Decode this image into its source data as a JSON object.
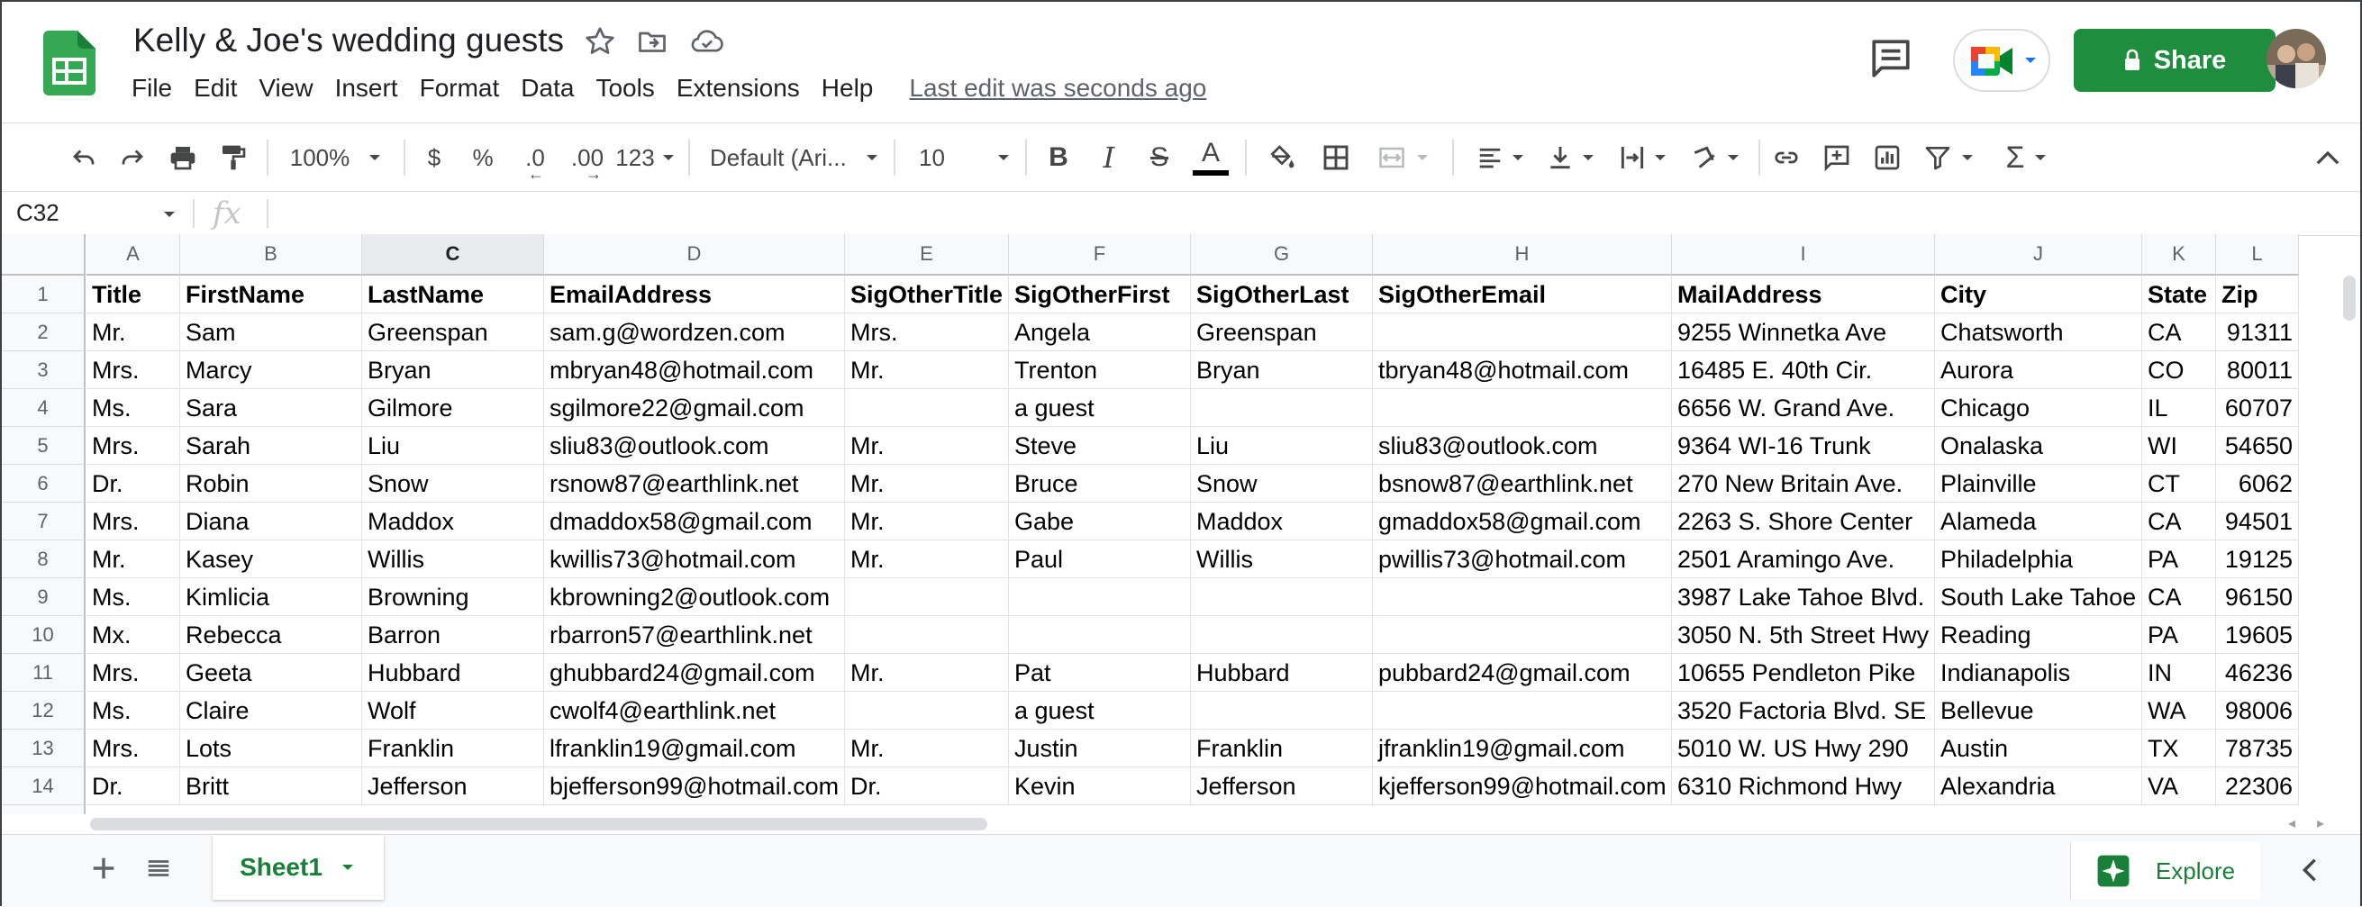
{
  "doc": {
    "title": "Kelly & Joe's wedding guests",
    "last_edit": "Last edit was seconds ago",
    "share_label": "Share"
  },
  "menu": [
    "File",
    "Edit",
    "View",
    "Insert",
    "Format",
    "Data",
    "Tools",
    "Extensions",
    "Help"
  ],
  "toolbar": {
    "zoom": "100%",
    "currency": "$",
    "percent": "%",
    "decrease_decimal": ".0",
    "increase_decimal": ".00",
    "more_formats": "123",
    "font": "Default (Ari...",
    "font_size": "10",
    "bold": "B",
    "italic": "I",
    "strikethrough": "S",
    "text_color_label": "A",
    "text_color": "#000000"
  },
  "formula_bar": {
    "cell_ref": "C32",
    "fx": "fx",
    "content": ""
  },
  "sheet": {
    "columns": [
      "A",
      "B",
      "C",
      "D",
      "E",
      "F",
      "G",
      "H",
      "I",
      "J",
      "K",
      "L"
    ],
    "selected_column": "C",
    "row_numbers": [
      "1",
      "2",
      "3",
      "4",
      "5",
      "6",
      "7",
      "8",
      "9",
      "10",
      "11",
      "12",
      "13",
      "14"
    ],
    "header_row": [
      "Title",
      "FirstName",
      "LastName",
      "EmailAddress",
      "SigOtherTitle",
      "SigOtherFirst",
      "SigOtherLast",
      "SigOtherEmail",
      "MailAddress",
      "City",
      "State",
      "Zip"
    ],
    "rows": [
      [
        "Mr.",
        "Sam",
        "Greenspan",
        "sam.g@wordzen.com",
        "Mrs.",
        "Angela",
        "Greenspan",
        "",
        "9255 Winnetka Ave",
        "Chatsworth",
        "CA",
        "91311"
      ],
      [
        "Mrs.",
        "Marcy",
        "Bryan",
        "mbryan48@hotmail.com",
        "Mr.",
        "Trenton",
        "Bryan",
        "tbryan48@hotmail.com",
        "16485 E. 40th Cir.",
        "Aurora",
        "CO",
        "80011"
      ],
      [
        "Ms.",
        "Sara",
        "Gilmore",
        "sgilmore22@gmail.com",
        "",
        "a guest",
        "",
        "",
        "6656 W. Grand Ave.",
        "Chicago",
        "IL",
        "60707"
      ],
      [
        "Mrs.",
        "Sarah",
        "Liu",
        "sliu83@outlook.com",
        "Mr.",
        "Steve",
        "Liu",
        "sliu83@outlook.com",
        "9364 WI-16 Trunk",
        "Onalaska",
        "WI",
        "54650"
      ],
      [
        "Dr.",
        "Robin",
        "Snow",
        "rsnow87@earthlink.net",
        "Mr.",
        "Bruce",
        "Snow",
        "bsnow87@earthlink.net",
        "270 New Britain Ave.",
        "Plainville",
        "CT",
        "6062"
      ],
      [
        "Mrs.",
        "Diana",
        "Maddox",
        "dmaddox58@gmail.com",
        "Mr.",
        "Gabe",
        "Maddox",
        "gmaddox58@gmail.com",
        "2263 S. Shore Center",
        "Alameda",
        "CA",
        "94501"
      ],
      [
        "Mr.",
        "Kasey",
        "Willis",
        "kwillis73@hotmail.com",
        "Mr.",
        "Paul",
        "Willis",
        "pwillis73@hotmail.com",
        "2501 Aramingo Ave.",
        "Philadelphia",
        "PA",
        "19125"
      ],
      [
        "Ms.",
        "Kimlicia",
        "Browning",
        "kbrowning2@outlook.com",
        "",
        "",
        "",
        "",
        "3987 Lake Tahoe Blvd.",
        "South Lake Tahoe",
        "CA",
        "96150"
      ],
      [
        "Mx.",
        "Rebecca",
        "Barron",
        "rbarron57@earthlink.net",
        "",
        "",
        "",
        "",
        "3050 N. 5th Street Hwy",
        "Reading",
        "PA",
        "19605"
      ],
      [
        "Mrs.",
        "Geeta",
        "Hubbard",
        "ghubbard24@gmail.com",
        "Mr.",
        "Pat",
        "Hubbard",
        "pubbard24@gmail.com",
        "10655 Pendleton Pike",
        "Indianapolis",
        "IN",
        "46236"
      ],
      [
        "Ms.",
        "Claire",
        "Wolf",
        "cwolf4@earthlink.net",
        "",
        "a guest",
        "",
        "",
        "3520 Factoria Blvd. SE",
        "Bellevue",
        "WA",
        "98006"
      ],
      [
        "Mrs.",
        "Lots",
        "Franklin",
        "lfranklin19@gmail.com",
        "Mr.",
        "Justin",
        "Franklin",
        "jfranklin19@gmail.com",
        "5010 W. US Hwy 290",
        "Austin",
        "TX",
        "78735"
      ],
      [
        "Dr.",
        "Britt",
        "Jefferson",
        "bjefferson99@hotmail.com",
        "Dr.",
        "Kevin",
        "Jefferson",
        "kjefferson99@hotmail.com",
        "6310 Richmond Hwy",
        "Alexandria",
        "VA",
        "22306"
      ]
    ]
  },
  "bottom_bar": {
    "sheet_tab": "Sheet1",
    "explore_label": "Explore"
  },
  "icons": {
    "logo": "google-sheets-logo",
    "star": "star-icon",
    "move": "move-to-folder-icon",
    "cloud": "cloud-saved-icon",
    "comments": "comment-history-icon",
    "meet": "google-meet-icon",
    "lock": "lock-icon",
    "add_sheet": "plus-icon",
    "all_sheets": "list-icon",
    "explore": "explore-icon",
    "side_panel": "chevron-left-icon"
  },
  "colors": {
    "brand_green": "#1e8e3e",
    "tab_green": "#188038"
  }
}
